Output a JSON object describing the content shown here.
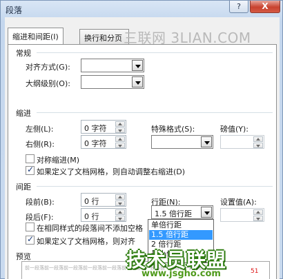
{
  "window": {
    "title": "段落",
    "help_label": "?",
    "close_label": "X"
  },
  "tabs": [
    {
      "label": "缩进和间距(I)"
    },
    {
      "label": "换行和分页"
    }
  ],
  "watermark": "三联网 3LIAN.COM",
  "general": {
    "title": "常规",
    "alignment_label": "对齐方式(G):",
    "alignment_value": "",
    "outline_label": "大纲级别(O):",
    "outline_value": ""
  },
  "indent": {
    "title": "缩进",
    "left_label": "左侧(L):",
    "left_value": "0 字符",
    "right_label": "右侧(R):",
    "right_value": "0 字符",
    "special_label": "特殊格式(S):",
    "special_value": "",
    "by_label": "磅值(Y):",
    "by_value": "",
    "mirror_label": "对称缩进(M)",
    "mirror_checked": false,
    "grid_label": "如果定义了文档网格，则自动调整右缩进(D)",
    "grid_checked": true
  },
  "spacing": {
    "title": "间距",
    "before_label": "段前(B):",
    "before_value": "0 行",
    "after_label": "段后(F):",
    "after_value": "0 行",
    "line_label": "行距(N):",
    "line_value": "1.5 倍行距",
    "at_label": "设置值(A):",
    "at_value": "",
    "same_style_label": "在相同样式的段落间不添加空格",
    "same_style_checked": false,
    "snap_label": "如果定义了文档网格，则对齐",
    "snap_checked": true,
    "line_options": [
      "单倍行距",
      "1.5 倍行距",
      "2 倍行距",
      "最小值"
    ],
    "line_selected_index": 1
  },
  "preview": {
    "title": "预览",
    "sample": "前一段落前一段落前一段落前一段落前一段落前一段落前一段落前一段落前一段落前一段落"
  },
  "branding": {
    "logo_text": "技术员联盟",
    "logo_url": "www.jsgho.com",
    "logo_tail": "51"
  }
}
